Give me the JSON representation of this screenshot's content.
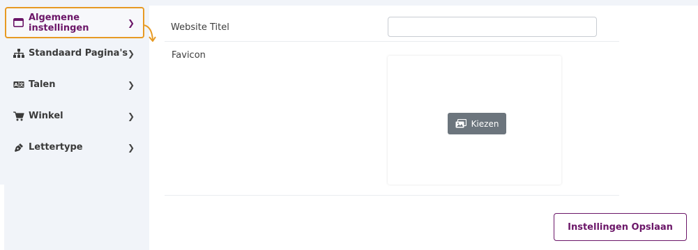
{
  "sidebar": {
    "items": [
      {
        "label": "Algemene instellingen",
        "icon": "window-icon",
        "active": true
      },
      {
        "label": "Standaard Pagina's",
        "icon": "sitemap-icon",
        "active": false
      },
      {
        "label": "Talen",
        "icon": "language-icon",
        "active": false
      },
      {
        "label": "Winkel",
        "icon": "cart-icon",
        "active": false
      },
      {
        "label": "Lettertype",
        "icon": "pen-nib-icon",
        "active": false
      }
    ]
  },
  "form": {
    "website_title_label": "Website Titel",
    "website_title_value": "",
    "favicon_label": "Favicon",
    "choose_button_label": "Kiezen"
  },
  "actions": {
    "save_label": "Instellingen Opslaan"
  },
  "colors": {
    "accent": "#6b1668",
    "highlight": "#e79a23",
    "sidebar_bg": "#f1f4f9",
    "secondary_button": "#6c757d"
  }
}
